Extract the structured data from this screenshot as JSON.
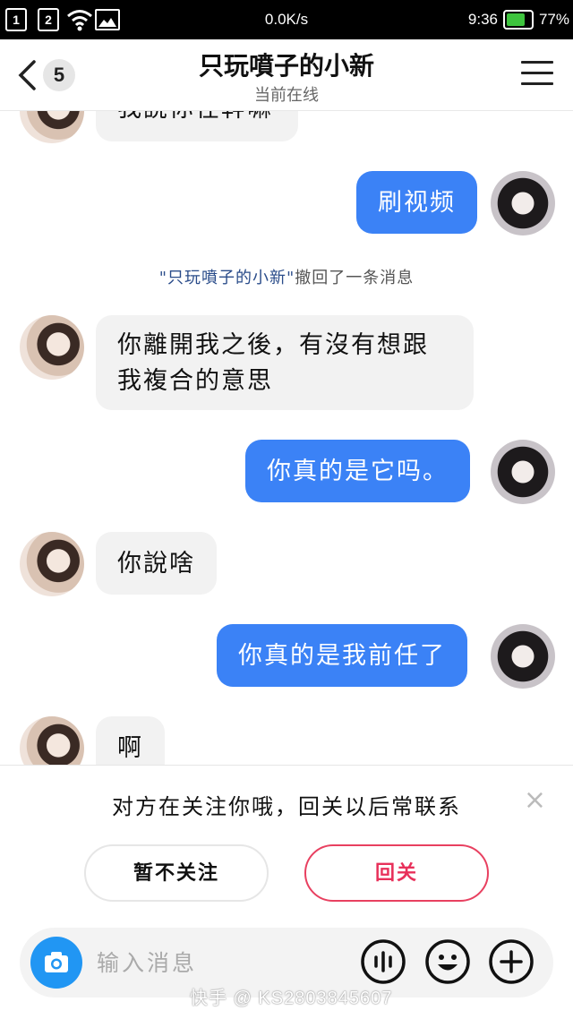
{
  "status_bar": {
    "sim1": "1",
    "sim2": "2",
    "net_speed": "0.0K/s",
    "time": "9:36",
    "battery_percent": "77%",
    "battery_level": 0.77
  },
  "header": {
    "unread_count": "5",
    "title": "只玩噴子的小新",
    "subtitle": "当前在线"
  },
  "messages": [
    {
      "side": "in",
      "text": "我說你在幹嘛"
    },
    {
      "side": "out",
      "text": "刷视频"
    },
    {
      "side": "notice",
      "name": "\"只玩噴子的小新\"",
      "text": "撤回了一条消息"
    },
    {
      "side": "in",
      "line1": "你離開我之後，有沒有想跟",
      "line2": "我複合的意思"
    },
    {
      "side": "out",
      "text": "你真的是它吗。"
    },
    {
      "side": "in",
      "text": "你說啥"
    },
    {
      "side": "out",
      "text": "你真的是我前任了"
    },
    {
      "side": "in",
      "text": "啊"
    }
  ],
  "follow_prompt": {
    "text": "对方在关注你哦，回关以后常联系",
    "close": "×",
    "later_label": "暂不关注",
    "follow_label": "回关"
  },
  "input": {
    "placeholder": "输入消息"
  },
  "watermark": "快手 @ KS2803845607",
  "colors": {
    "outgoing_bubble": "#3b82f6",
    "incoming_bubble": "#f2f2f2",
    "follow_accent": "#e8305a",
    "camera_button": "#2196f3"
  },
  "icons": [
    "back-chevron-icon",
    "menu-icon",
    "camera-icon",
    "voice-icon",
    "emoji-icon",
    "plus-icon",
    "close-icon"
  ]
}
